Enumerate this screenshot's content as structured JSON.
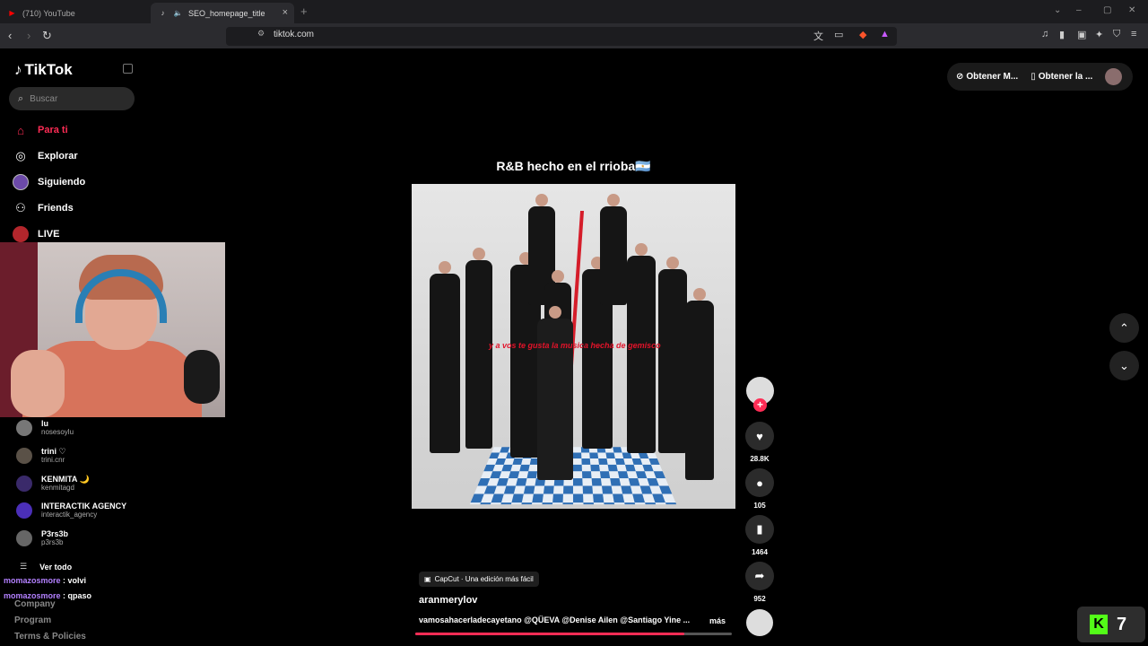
{
  "browser": {
    "tabs": [
      {
        "title": "(710) YouTube",
        "favicon": "youtube-icon"
      },
      {
        "title": "SEO_homepage_title",
        "favicon": "tiktok-icon"
      }
    ],
    "url": "tiktok.com"
  },
  "sidebar": {
    "brand": "TikTok",
    "search_placeholder": "Buscar",
    "nav": [
      {
        "label": "Para ti",
        "icon": "home-icon"
      },
      {
        "label": "Explorar",
        "icon": "compass-icon"
      },
      {
        "label": "Siguiendo",
        "icon": "avatar-icon"
      },
      {
        "label": "Friends",
        "icon": "friends-icon"
      },
      {
        "label": "LIVE",
        "icon": "live-icon"
      }
    ],
    "accounts": [
      {
        "name": "lu",
        "username": "nosesoylu"
      },
      {
        "name": "trini ♡",
        "username": "trini.cnr"
      },
      {
        "name": "KENMITA 🌙",
        "username": "kenmitagd"
      },
      {
        "name": "INTERACTIK AGENCY",
        "username": "interactik_agency"
      },
      {
        "name": "P3rs3b",
        "username": "p3rs3b"
      }
    ],
    "see_all": "Ver todo",
    "footer": [
      "Company",
      "Program",
      "Terms & Policies"
    ]
  },
  "chat": [
    {
      "user": "momazosmore",
      "msg": "volvi"
    },
    {
      "user": "momazosmore",
      "msg": "qpaso"
    }
  ],
  "header": {
    "btn1": "Obtener M...",
    "btn2": "Obtener la ..."
  },
  "video": {
    "title": "R&B hecho en el rrioba🇦🇷",
    "subtitle": "y a vos te gusta la musica hecha de gemisco",
    "capcut": "CapCut · Una edición más fácil",
    "author": "aranmerylov",
    "description": "vamosahacerladecayetano @QÜEVA @Denise Ailen @Santiago Yine ...",
    "more": "más",
    "progress": 0.85
  },
  "actions": {
    "likes": "28.8K",
    "comments": "105",
    "saves": "1464",
    "shares": "952"
  },
  "overlay": {
    "kick_count": "7"
  }
}
